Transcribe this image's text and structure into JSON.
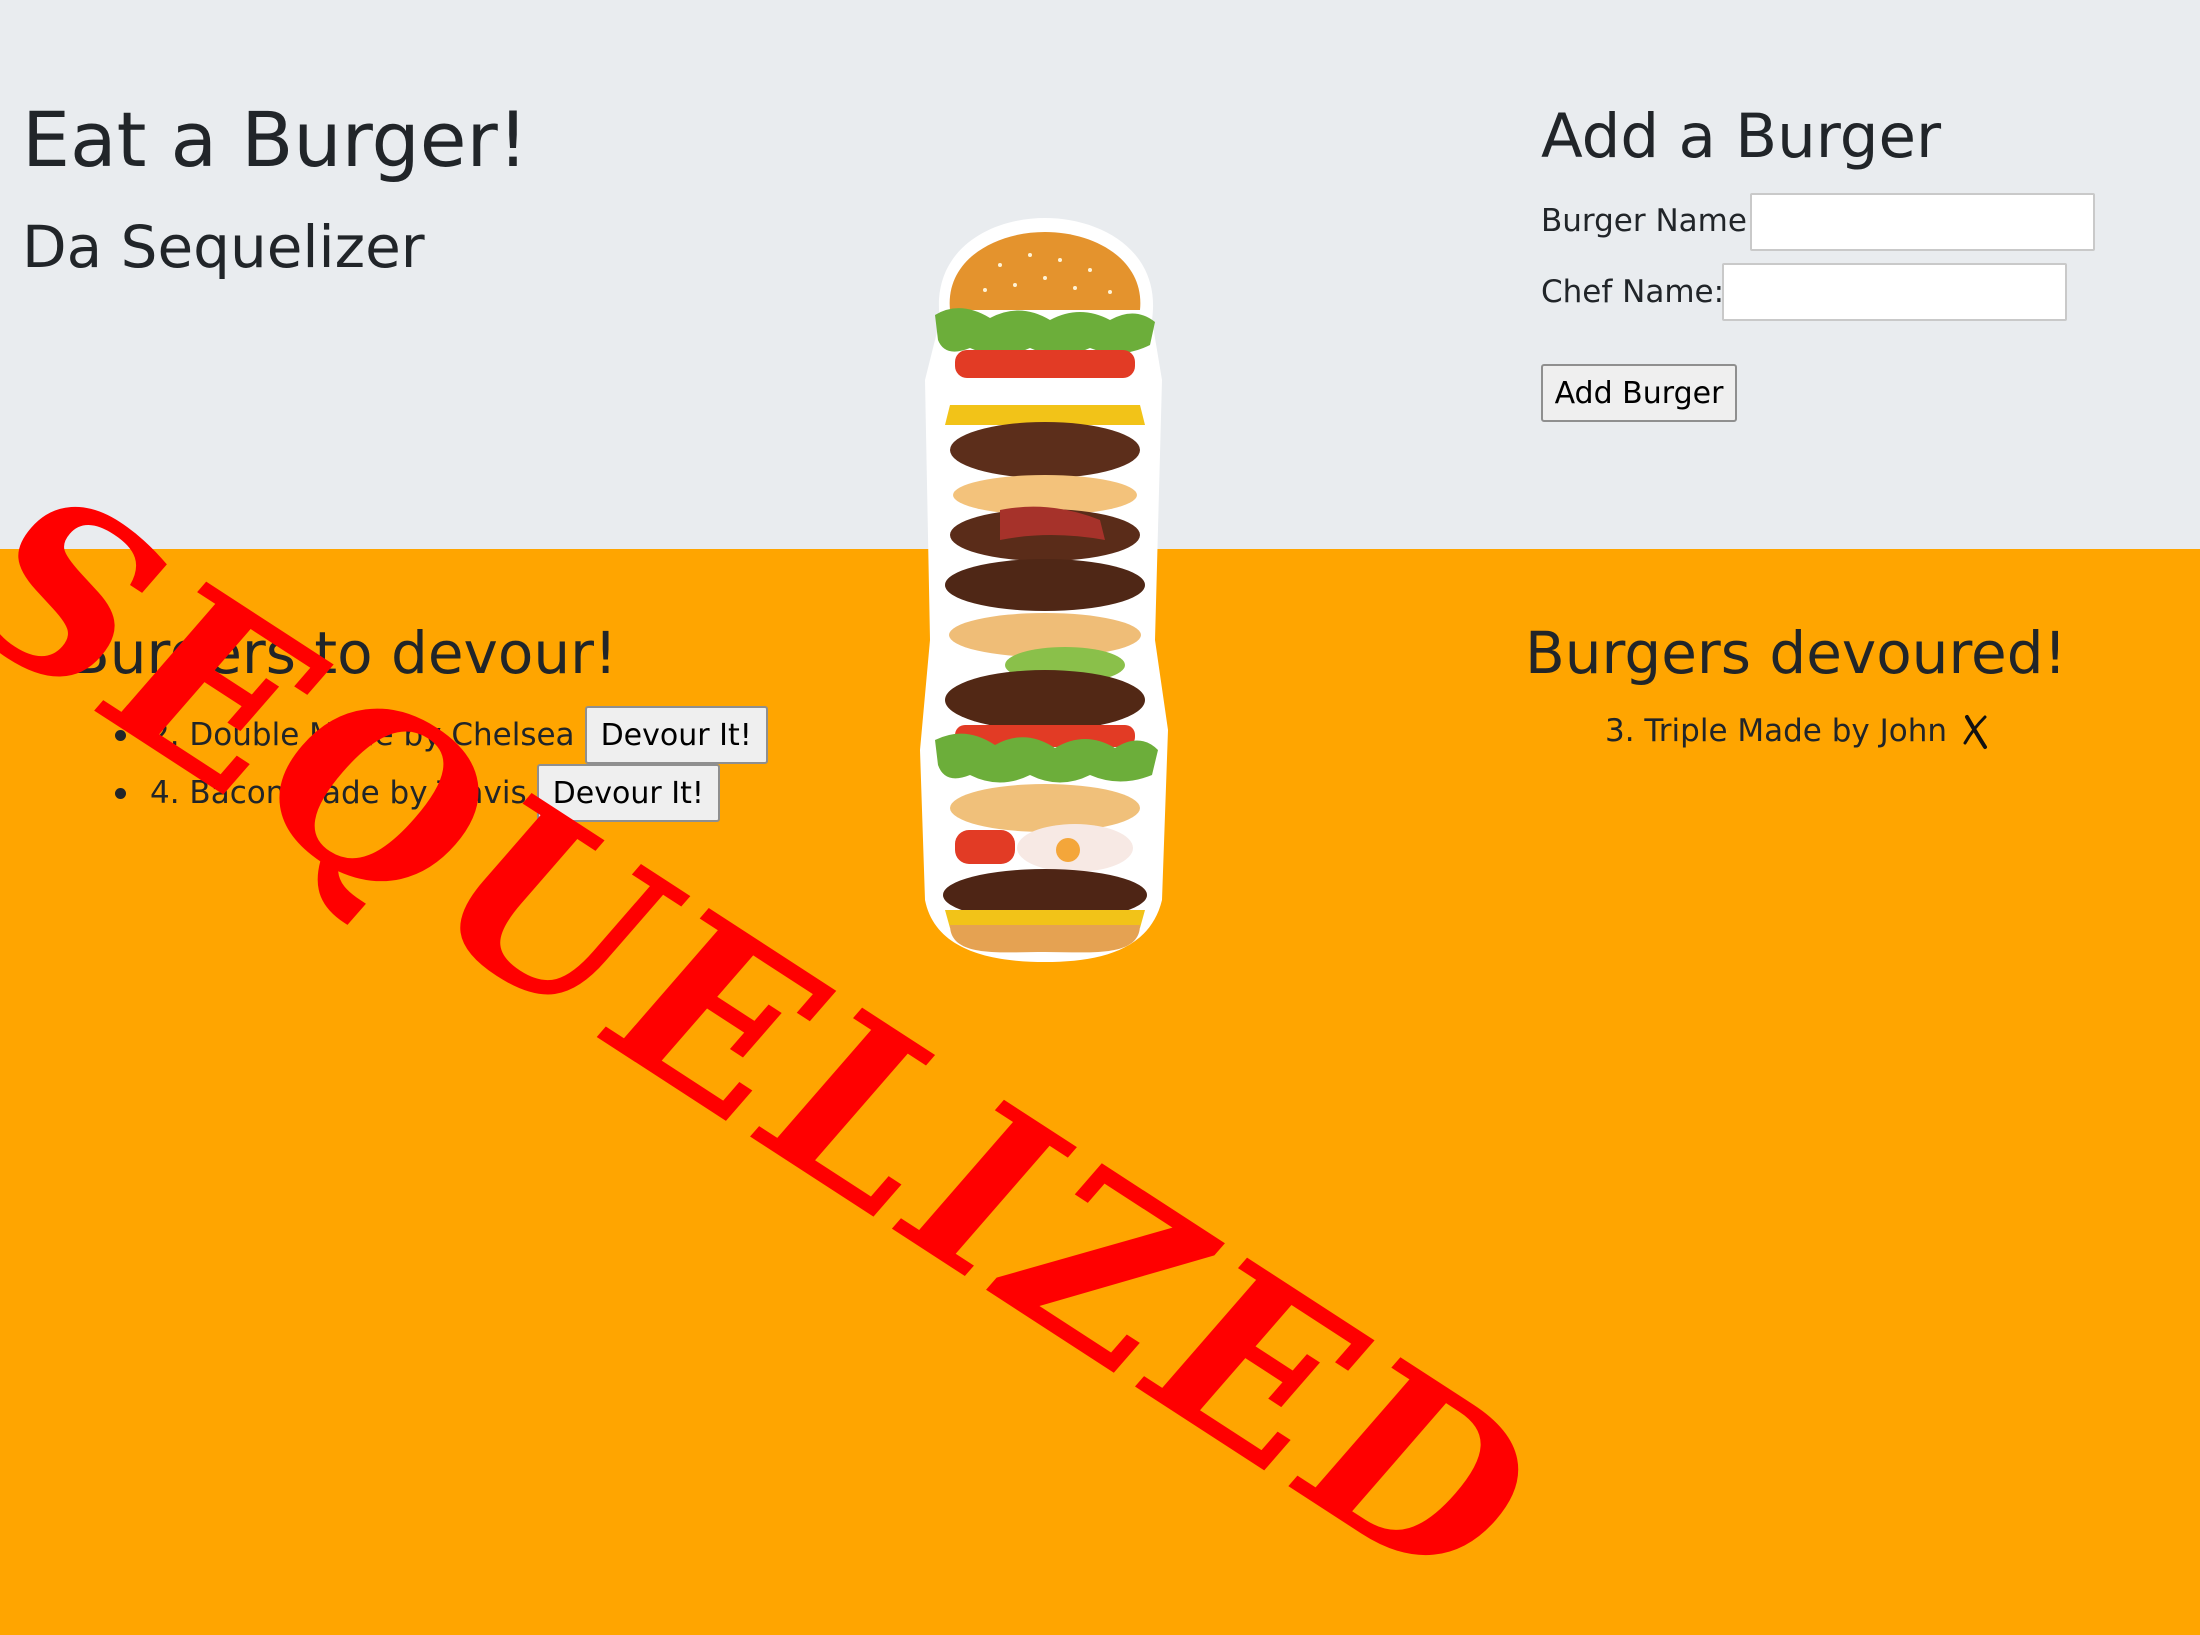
{
  "header": {
    "title": "Eat a Burger!",
    "subtitle": "Da Sequelizer"
  },
  "form": {
    "title": "Add a Burger",
    "burger_name_label": "Burger Name:",
    "burger_name_value": "",
    "chef_name_label": "Chef Name:",
    "chef_name_value": "",
    "submit_label": "Add Burger"
  },
  "to_devour": {
    "heading": "Burgers to devour!",
    "items": [
      {
        "text": "2. Double Made by Chelsea",
        "button_label": "Devour It!"
      },
      {
        "text": "4. Bacon Made by Travis",
        "button_label": "Devour It!"
      }
    ]
  },
  "devoured": {
    "heading": "Burgers devoured!",
    "items": [
      {
        "text": "3. Triple Made by John",
        "icon": "close-icon"
      }
    ]
  },
  "stamp": {
    "text": "SEQUELIZED"
  },
  "colors": {
    "header_bg": "#e9ecef",
    "body_bg": "#ffa500",
    "stamp_red": "#ff0000",
    "text_dark": "#212529"
  }
}
